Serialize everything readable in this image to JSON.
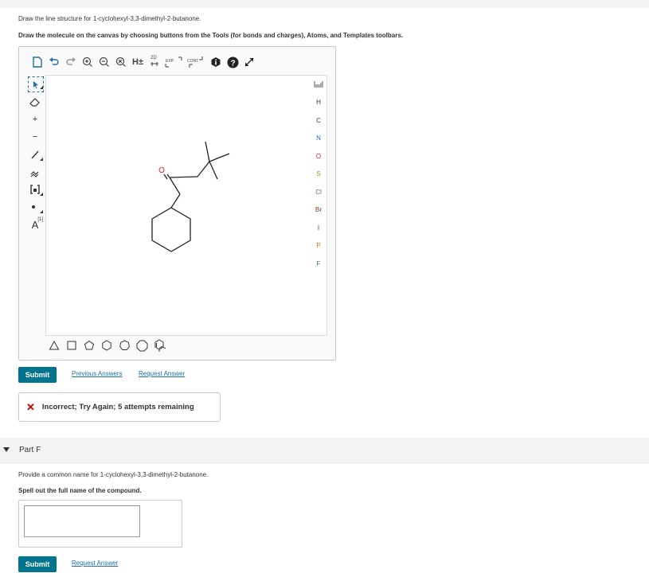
{
  "question": {
    "prompt": "Draw the line structure for 1-cyclohexyl-3,3-dimethyl-2-butanone.",
    "instruction": "Draw the molecule on the canvas by choosing buttons from the Tools (for bonds and charges), Atoms, and Templates toolbars."
  },
  "toolbar": {
    "icons": [
      "new-document-icon",
      "undo-icon",
      "redo-icon",
      "zoom-in-icon",
      "zoom-out-icon",
      "clear-icon",
      "hydrogen-toggle-icon",
      "2d-clean-icon",
      "expand-icon",
      "contract-icon",
      "info-icon",
      "help-icon",
      "fullscreen-icon"
    ],
    "h_label": "H±",
    "label_2d": "2D",
    "exp_label": "EXP.",
    "cont_label": "CONT."
  },
  "left_tools": {
    "charge_plus": "+",
    "charge_minus": "−",
    "atom_label_tool": "A",
    "atom_label_sup": "[1]"
  },
  "molecule": {
    "oxygen_label": "O"
  },
  "atoms": {
    "periodic_table_icon": "periodic-table-icon",
    "items": [
      "H",
      "C",
      "N",
      "O",
      "S",
      "Cl",
      "Br",
      "I",
      "P",
      "F"
    ],
    "colors": {
      "H": "#333333",
      "C": "#333333",
      "N": "#2b5fc7",
      "O": "#d22",
      "S": "#b08a00",
      "Cl": "#3a8a3a",
      "Br": "#8a3a1a",
      "I": "#6a2a8a",
      "P": "#d07a00",
      "F": "#3a8a3a"
    }
  },
  "templates": [
    "triangle",
    "square",
    "pentagon",
    "hexagon",
    "heptagon",
    "octagon",
    "benzene"
  ],
  "part_e_actions": {
    "submit": "Submit",
    "previous": "Previous Answers",
    "request": "Request Answer"
  },
  "feedback": {
    "text": "Incorrect; Try Again; 5 attempts remaining"
  },
  "part_f": {
    "label": "Part F",
    "prompt": "Provide a common name for 1-cyclohexyl-3,3-dimethyl-2-butanone.",
    "instruction": "Spell out the full name of the compound.",
    "input_value": "",
    "submit": "Submit",
    "request": "Request Answer"
  }
}
